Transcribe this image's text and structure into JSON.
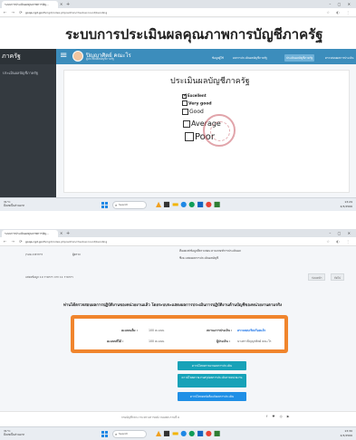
{
  "shot1": {
    "browser": {
      "tab_title": "ระบบการประเมินผลคุณภาพการบัญ...",
      "url_host": "goqa.cgd.go.th",
      "url_path": "/cgd/index.php/admin/checkaccount/bending"
    },
    "system_title": "ระบบการประเมินผลคุณภาพการบัญชีภาครัฐ",
    "sidebar": {
      "brand": "ภาครัฐ",
      "item": "ประเมินผลบัญชีภาครัฐ"
    },
    "user": {
      "name": "ปิญญาศิตย์ คณะโร",
      "subtitle": "ผู้ประเมินผลบัญชีภาครัฐ"
    },
    "menu": [
      "ข้อมูลผู้ใช้",
      "ผลการประเมินผลบัญชีภาครัฐ",
      "ประเมินผลบัญชีภาครัฐ",
      "ตรวจสอบผลการประเมิน"
    ],
    "form": {
      "title": "ประเมินผลบัญชีภาครัฐ",
      "options": [
        {
          "label": "Excellent",
          "checked": true
        },
        {
          "label": "Very good",
          "checked": false
        },
        {
          "label": "Good",
          "checked": false
        },
        {
          "label": "Average",
          "checked": false
        },
        {
          "label": "Poor",
          "checked": false
        }
      ]
    },
    "taskbar": {
      "weather_temp": "31°C",
      "weather_desc": "มีเมฆเป็นส่วนมาก",
      "search_label": "Search",
      "time": "13:29",
      "date": "2/3/2566"
    }
  },
  "shot2": {
    "browser": {
      "tab_title": "ระบบการประเมินผลคุณภาพการบัญ...",
      "url_host": "goqa.cgd.go.th",
      "url_path": "/cgd/index.php/admin/checkaccount/bending"
    },
    "table": {
      "row_a": [
        "(ระยะเวลาการ",
        "ผู้ตรวจ"
      ],
      "row_a_detail": "ที่เผยแพร่ข้อมูลที่ตรวจสอบ ตามเกณฑ์การประเมินผล",
      "row_b_detail": "ซึ่งจะแสดงผลการประเมินผลบัญชี"
    },
    "pager": {
      "info": "แสดงข้อมูล 10 รายการ จาก 11 รายการ",
      "prev": "ก่อนหน้า",
      "next": "ถัดไป"
    },
    "checked_heading": "ท่านได้ตรวจสอบผลการปฏิบัติงานของหน่วยงานแล้ว โดยระบบจะแสดงผลการประเมินการปฏิบัติงานด้านบัญชีของหน่วยงานตามจริง",
    "summary": {
      "total_label": "คะแนนเต็ม :",
      "total_value": "100 คะแนน",
      "score_label": "คะแนนที่ได้ :",
      "score_value": "100 คะแนน",
      "status_label": "สถานะการประเมิน :",
      "status_value": "ตรวจสอบเรียบร้อยแล้ว",
      "assessor_label": "ผู้ประเมิน :",
      "assessor_value": "นางสาวปิญญาศิตย์ คณะโร"
    },
    "actions": [
      "ดาวน์โหลดรายงานผลการประเมิน",
      "ดาวน์โหลดรายงานสรุปผลการประเมินรายหน่วยงาน",
      "ดาวน์โหลดหนังสือแจ้งผลการประเมิน"
    ],
    "footer": {
      "text": "กรมบัญชีกลาง กระทรวงการคลัง ถนนพระรามที่ 6",
      "social": "f ♥ ◎ ▶"
    },
    "taskbar": {
      "weather_temp": "31°C",
      "weather_desc": "มีเมฆเป็นส่วนมาก",
      "search_label": "Search",
      "time": "13:30",
      "date": "2/3/2566"
    }
  }
}
